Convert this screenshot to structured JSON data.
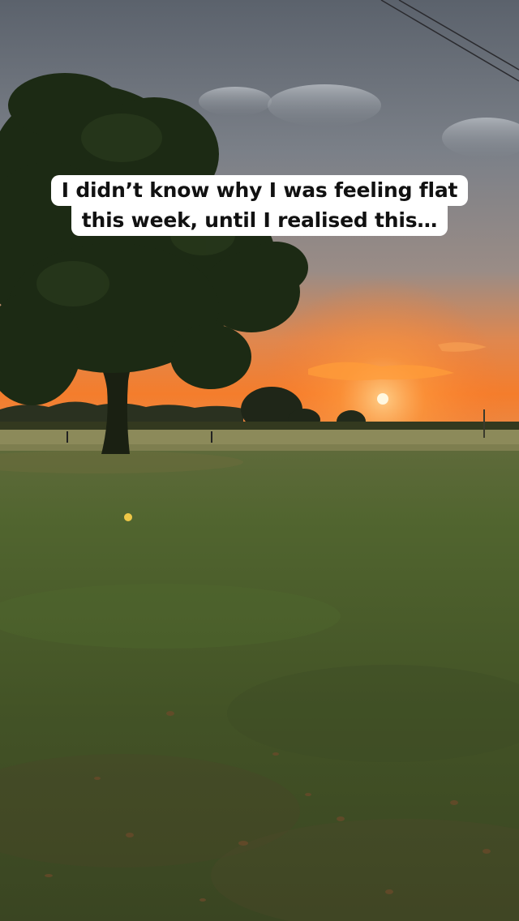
{
  "caption": {
    "line1": "I didn’t know why I was feeling flat",
    "line2": "this week, until I realised this…"
  },
  "colors": {
    "sky_top": "#5f6670",
    "sky_mid": "#8a8f96",
    "sunset_orange": "#f07a2a",
    "sun": "#fff6d8",
    "grass": "#4b5e2f",
    "tree": "#1b2414"
  }
}
